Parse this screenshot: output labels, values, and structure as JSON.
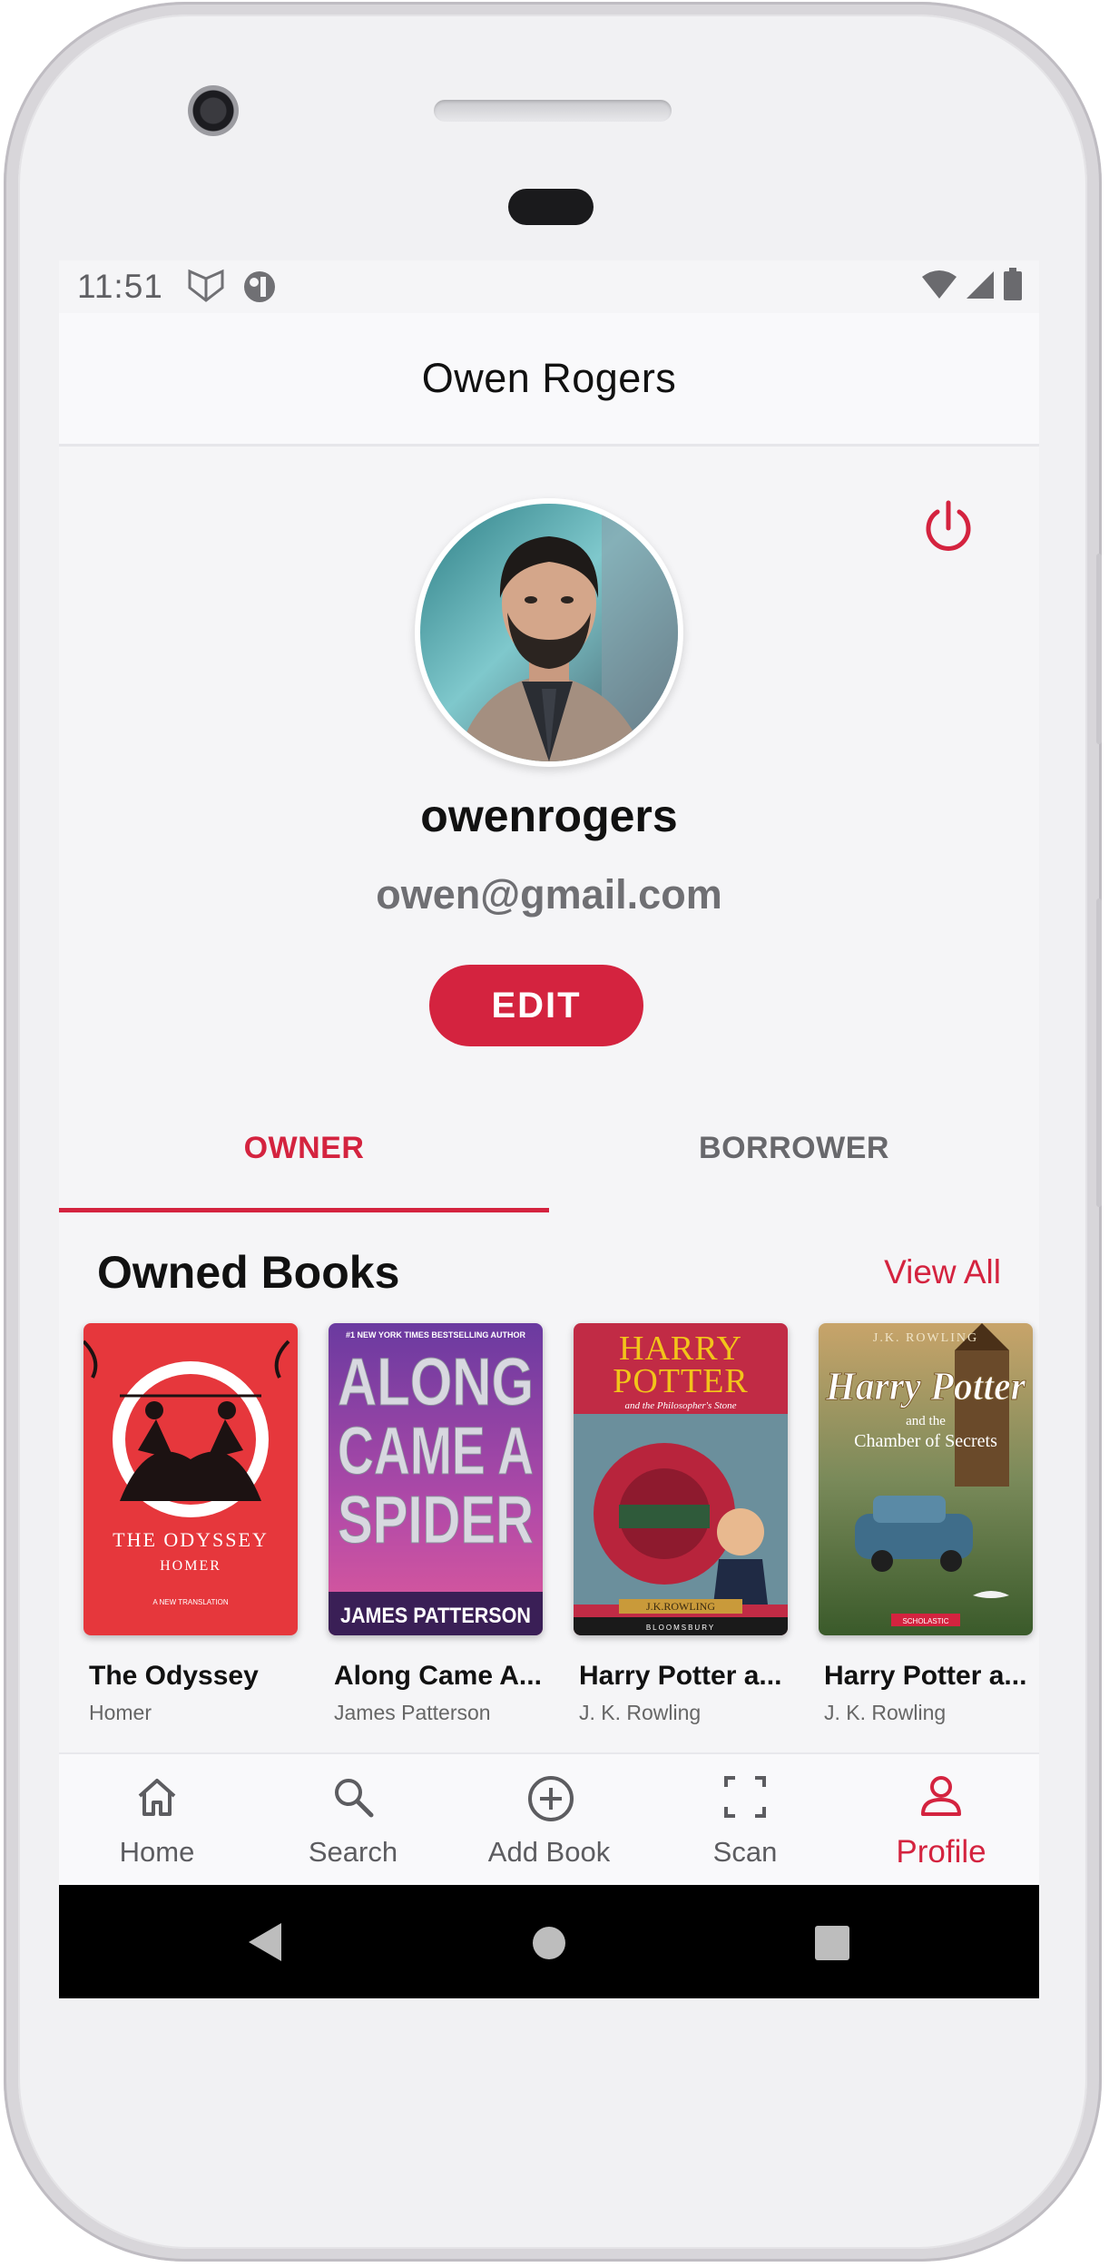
{
  "status_bar": {
    "time": "11:51",
    "icons_left": [
      "brand-shield-icon",
      "notification-app-icon"
    ],
    "icons_right": [
      "wifi-icon",
      "signal-icon",
      "battery-icon"
    ]
  },
  "app_bar": {
    "title": "Owen Rogers"
  },
  "profile": {
    "username": "owenrogers",
    "email": "owen@gmail.com",
    "edit_label": "EDIT",
    "logout_icon": "power-icon"
  },
  "tabs": [
    {
      "label": "OWNER",
      "active": true
    },
    {
      "label": "BORROWER",
      "active": false
    }
  ],
  "owned_section": {
    "title": "Owned Books",
    "view_all_label": "View All"
  },
  "books": [
    {
      "title": "The Odyssey",
      "author": "Homer",
      "cover_text": [
        "THE ODYSSEY",
        "HOMER",
        "A NEW TRANSLATION"
      ],
      "cover_color": "#e8373d"
    },
    {
      "title": "Along Came A...",
      "author": "James Patterson",
      "cover_text": [
        "#1 NEW YORK TIMES BESTSELLING AUTHOR",
        "ALONG",
        "CAME A",
        "SPIDER",
        "JAMES PATTERSON"
      ],
      "cover_color": "#8a3fb5"
    },
    {
      "title": "Harry Potter a...",
      "author": "J. K. Rowling",
      "cover_text": [
        "HARRY",
        "POTTER",
        "and the Philosopher's Stone",
        "J.K.ROWLING",
        "BLOOMSBURY"
      ],
      "cover_color": "#b8253c"
    },
    {
      "title": "Harry Potter a...",
      "author": "J. K. Rowling",
      "cover_text": [
        "J.K. ROWLING",
        "Harry Potter",
        "and the",
        "Chamber of Secrets",
        "SCHOLASTIC"
      ],
      "cover_color": "#4e6a3a"
    }
  ],
  "bottom_nav": [
    {
      "label": "Home",
      "icon": "home-icon",
      "active": false
    },
    {
      "label": "Search",
      "icon": "search-icon",
      "active": false
    },
    {
      "label": "Add Book",
      "icon": "add-circle-icon",
      "active": false
    },
    {
      "label": "Scan",
      "icon": "scan-icon",
      "active": false
    },
    {
      "label": "Profile",
      "icon": "person-icon",
      "active": true
    }
  ],
  "system_nav": [
    "back-icon",
    "home-circle-icon",
    "recents-icon"
  ],
  "colors": {
    "accent": "#d4233f",
    "background": "#f5f5f7",
    "text_primary": "#111111",
    "text_secondary": "#6f6f73"
  }
}
